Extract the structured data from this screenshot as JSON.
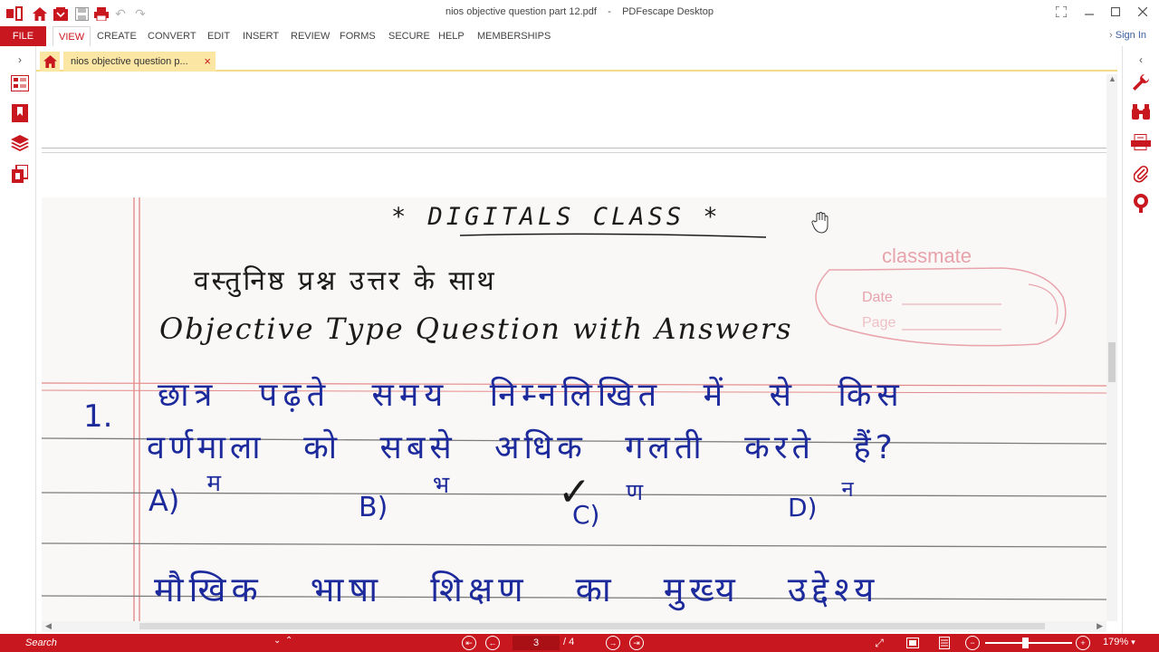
{
  "window": {
    "title": "nios objective question part 12.pdf",
    "separator": "-",
    "app_name": "PDFescape Desktop"
  },
  "menu": {
    "file": "FILE",
    "items": [
      "VIEW",
      "CREATE",
      "CONVERT",
      "EDIT",
      "INSERT",
      "REVIEW",
      "FORMS",
      "SECURE",
      "HELP",
      "MEMBERSHIPS"
    ],
    "active": "VIEW",
    "sign_in": "Sign In"
  },
  "tabs": {
    "document_tab": "nios objective question p...",
    "close_glyph": "×"
  },
  "document": {
    "heading": "* DIGITALS CLASS *",
    "hindi_subtitle": "वस्तुनिष्ठ प्रश्न उत्तर के साथ",
    "english_subtitle": "Objective Type Question with Answers",
    "classmate_brand": "classmate",
    "date_label": "Date",
    "page_label": "Page",
    "q1_number": "1.",
    "q1_line1": "छात्र पढ़ते समय निम्नलिखित में से किस",
    "q1_line2": "वर्णमाला को सबसे अधिक गलती करते हैं?",
    "options": [
      {
        "label": "A)",
        "text": "म"
      },
      {
        "label": "B)",
        "text": "भ"
      },
      {
        "label": "C)",
        "text": "ण"
      },
      {
        "label": "D)",
        "text": "न"
      }
    ],
    "checkmark": "✓",
    "q2_line1": "मौखिक भाषा शिक्षण का मुख्य उद्देश्य"
  },
  "statusbar": {
    "search_placeholder": "Search",
    "page_current": "3",
    "page_total": "/ 4",
    "zoom": "179%"
  },
  "colors": {
    "brand_red": "#c8171e",
    "ink_blue": "#1d2a9c",
    "ink_black": "#1b1b1b",
    "margin_red": "#e07a7a",
    "rule_gray": "#7c7c7c",
    "tab_yellow": "#fbe7a3"
  }
}
